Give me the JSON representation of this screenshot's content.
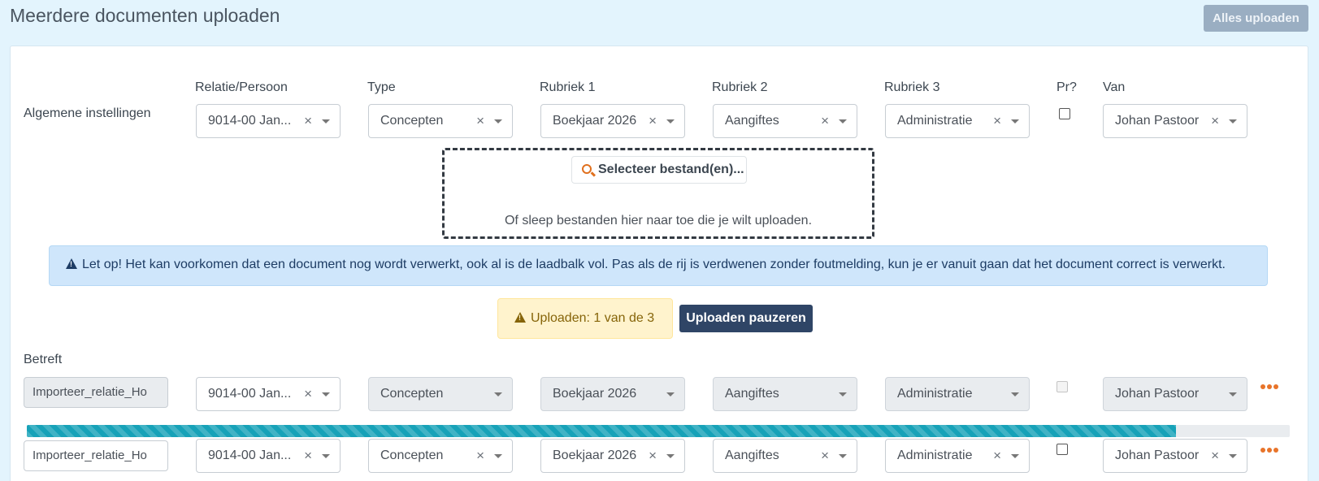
{
  "page": {
    "title": "Meerdere documenten uploaden",
    "upload_all_label": "Alles uploaden"
  },
  "columns": {
    "relatie": "Relatie/Persoon",
    "type": "Type",
    "rubriek1": "Rubriek 1",
    "rubriek2": "Rubriek 2",
    "rubriek3": "Rubriek 3",
    "private": "Pr?",
    "van": "Van"
  },
  "general": {
    "label": "Algemene instellingen",
    "relatie": "9014-00 Jan...",
    "type": "Concepten",
    "rubriek1": "Boekjaar 2026",
    "rubriek2": "Aangiftes",
    "rubriek3": "Administratie",
    "van": "Johan Pastoor",
    "clear_glyph": "×"
  },
  "dropzone": {
    "select_label": "Selecteer bestand(en)...",
    "hint": "Of sleep bestanden hier naar toe die je wilt uploaden."
  },
  "info_alert": "Let op! Het kan voorkomen dat een document nog wordt verwerkt, ook al is de laadbalk vol. Pas als de rij is verdwenen zonder foutmelding, kun je er vanuit gaan dat het document correct is verwerkt.",
  "upload_status": {
    "text": "Uploaden: 1 van de 3",
    "pause_label": "Uploaden pauzeren"
  },
  "betreft_label": "Betreft",
  "rows": [
    {
      "filename": "Importeer_relatie_Ho",
      "relatie": "9014-00 Jan...",
      "type": "Concepten",
      "rubriek1": "Boekjaar 2026",
      "rubriek2": "Aangiftes",
      "rubriek3": "Administratie",
      "van": "Johan Pastoor",
      "progress": 0.91
    },
    {
      "filename": "Importeer_relatie_Ho",
      "relatie": "9014-00 Jan...",
      "type": "Concepten",
      "rubriek1": "Boekjaar 2026",
      "rubriek2": "Aangiftes",
      "rubriek3": "Administratie",
      "van": "Johan Pastoor"
    }
  ],
  "colors": {
    "accent": "#2f4566",
    "progress": "#17a2b8",
    "menu_dots": "#e8742a"
  }
}
